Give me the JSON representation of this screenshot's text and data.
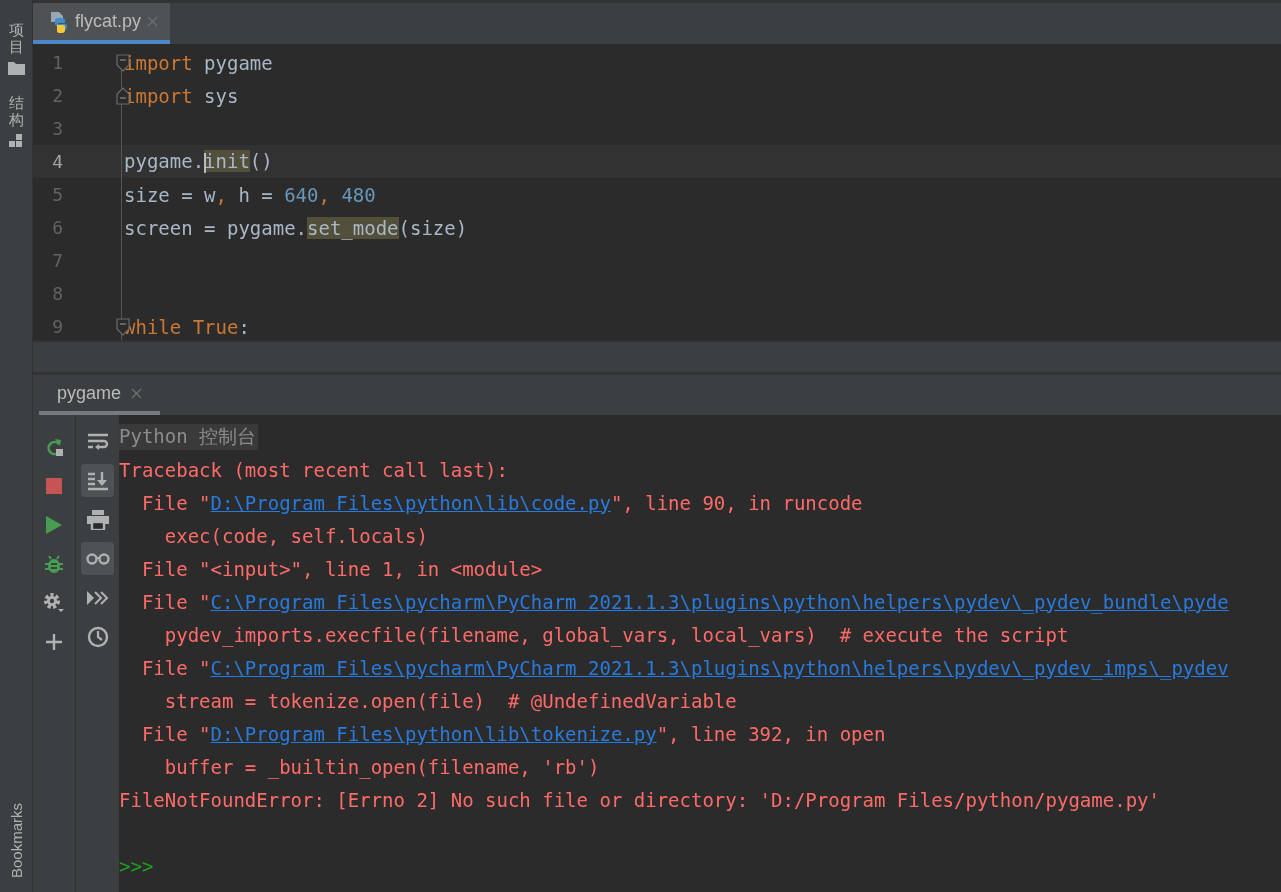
{
  "left_stripe": [
    {
      "kind": "project",
      "label": "项目"
    },
    {
      "kind": "structure",
      "label": "结构"
    },
    {
      "kind": "bookmarks",
      "label": "Bookmarks"
    }
  ],
  "editor": {
    "tabs": [
      {
        "label": "flycat.py",
        "selected": true
      }
    ],
    "lines": [
      {
        "number": "1",
        "current": false,
        "kind": "fold-start",
        "tokens": [
          {
            "text": "import",
            "kind": "keyword"
          },
          {
            "text": " pygame",
            "kind": "plain"
          }
        ]
      },
      {
        "number": "2",
        "current": false,
        "kind": "fold-end",
        "tokens": [
          {
            "text": "import",
            "kind": "keyword"
          },
          {
            "text": " sys",
            "kind": "plain"
          }
        ]
      },
      {
        "number": "3",
        "current": false,
        "kind": "plain"
      },
      {
        "number": "4",
        "current": true,
        "kind": "plain",
        "tokens": [
          {
            "text": "pygame.",
            "kind": "plain"
          },
          {
            "text": "init",
            "kind": "usage",
            "caret": true
          },
          {
            "text": "()",
            "kind": "plain"
          }
        ]
      },
      {
        "number": "5",
        "current": false,
        "kind": "plain",
        "tokens": [
          {
            "text": "size = w",
            "kind": "plain"
          },
          {
            "text": ", ",
            "kind": "keyword"
          },
          {
            "text": "h = ",
            "kind": "plain"
          },
          {
            "text": "640",
            "kind": "number"
          },
          {
            "text": ", ",
            "kind": "keyword"
          },
          {
            "text": "480",
            "kind": "number"
          }
        ]
      },
      {
        "number": "6",
        "current": false,
        "kind": "plain",
        "tokens": [
          {
            "text": "screen = pygame.",
            "kind": "plain"
          },
          {
            "text": "set_mode",
            "kind": "usage"
          },
          {
            "text": "(size)",
            "kind": "plain"
          }
        ]
      },
      {
        "number": "7",
        "current": false,
        "kind": "plain"
      },
      {
        "number": "8",
        "current": false,
        "kind": "plain"
      },
      {
        "number": "9",
        "current": false,
        "kind": "fold-start",
        "tokens": [
          {
            "text": "while",
            "kind": "keyword"
          },
          {
            "text": " True",
            "kind": "keyword"
          },
          {
            "text": ":",
            "kind": "plain"
          }
        ]
      }
    ]
  },
  "console": {
    "tabs": [
      {
        "label": "pygame",
        "selected": true
      }
    ],
    "actions": [
      {
        "kind": "rerun"
      },
      {
        "kind": "stop"
      },
      {
        "kind": "run"
      },
      {
        "kind": "debug"
      },
      {
        "kind": "settings"
      },
      {
        "kind": "add"
      }
    ],
    "tools": [
      {
        "kind": "wrap",
        "selected": false
      },
      {
        "kind": "scroll-end",
        "selected": true
      },
      {
        "kind": "print",
        "selected": false
      },
      {
        "kind": "glasses",
        "selected": true
      },
      {
        "kind": "forward",
        "selected": false
      },
      {
        "kind": "history",
        "selected": false
      }
    ],
    "lines": [
      {
        "kind": "header",
        "parts": [
          {
            "text": "Python 控制台"
          }
        ]
      },
      {
        "kind": "error",
        "parts": [
          {
            "text": "Traceback (most recent call last):"
          }
        ],
        "children": [
          {
            "kind": "error",
            "parts": [
              {
                "text": "File \""
              },
              {
                "text": "D:\\Program Files\\python\\lib\\code.py",
                "link": true
              },
              {
                "text": "\", line 90, in runcode"
              }
            ],
            "children": [
              {
                "kind": "error",
                "parts": [
                  {
                    "text": "exec(code, self.locals)"
                  }
                ]
              }
            ]
          },
          {
            "kind": "error",
            "parts": [
              {
                "text": "File \"<input>\", line 1, in <module>"
              }
            ]
          },
          {
            "kind": "error",
            "parts": [
              {
                "text": "File \""
              },
              {
                "text": "C:\\Program Files\\pycharm\\PyCharm 2021.1.3\\plugins\\python\\helpers\\pydev\\_pydev_bundle\\pyde",
                "link": true
              }
            ],
            "children": [
              {
                "kind": "error",
                "parts": [
                  {
                    "text": "pydev_imports.execfile(filename, global_vars, local_vars)  # execute the script"
                  }
                ]
              }
            ]
          },
          {
            "kind": "error",
            "parts": [
              {
                "text": "File \""
              },
              {
                "text": "C:\\Program Files\\pycharm\\PyCharm 2021.1.3\\plugins\\python\\helpers\\pydev\\_pydev_imps\\_pydev",
                "link": true
              }
            ],
            "children": [
              {
                "kind": "error",
                "parts": [
                  {
                    "text": "stream = tokenize.open(file)  # @UndefinedVariable"
                  }
                ]
              }
            ]
          },
          {
            "kind": "error",
            "parts": [
              {
                "text": "File \""
              },
              {
                "text": "D:\\Program Files\\python\\lib\\tokenize.py",
                "link": true
              },
              {
                "text": "\", line 392, in open"
              }
            ],
            "children": [
              {
                "kind": "error",
                "parts": [
                  {
                    "text": "buffer = _builtin_open(filename, 'rb')"
                  }
                ]
              }
            ]
          }
        ]
      },
      {
        "kind": "error",
        "parts": [
          {
            "text": "FileNotFoundError: [Errno 2] No such file or directory: 'D:/Program Files/python/pygame.py'"
          }
        ]
      },
      {
        "kind": "blank"
      },
      {
        "kind": "prompt",
        "parts": [
          {
            "text": ">>>"
          }
        ]
      }
    ]
  }
}
